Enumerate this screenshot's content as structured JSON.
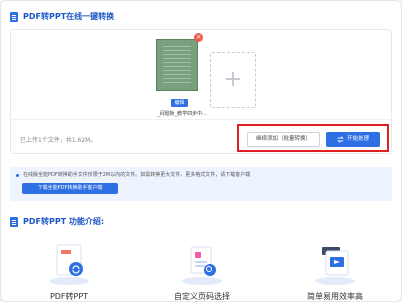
{
  "header": {
    "title": "PDF转PPT在线一键转换"
  },
  "upload": {
    "file_name": "_闷题板_教学四步中...",
    "edit_badge": "编辑",
    "remove_label": "×",
    "add_label": "+",
    "status": "已上传1个文件，共1.62M。"
  },
  "actions": {
    "continue_label": "继续添加（批量转换）",
    "start_label": "开始处理",
    "start_icon": "convert-icon"
  },
  "notice": {
    "text": "在线版全能PDF转换助手文件仅限于2M以内的文件。如需转换更大文件、更多格式文件，请下载客户端",
    "button_label": "下载全能PDF转换助手客户端"
  },
  "features_section": {
    "title": "PDF转PPT 功能介绍:",
    "items": [
      {
        "label": "PDF转PPT",
        "icon": "pdf-to-ppt-icon"
      },
      {
        "label": "自定义页码选择",
        "icon": "page-select-icon"
      },
      {
        "label": "简单易用效率高",
        "icon": "doc-convert-icon"
      }
    ]
  },
  "colors": {
    "accent": "#2f6fe4",
    "highlight": "#e02020",
    "notice_bg": "#eef4ff"
  }
}
